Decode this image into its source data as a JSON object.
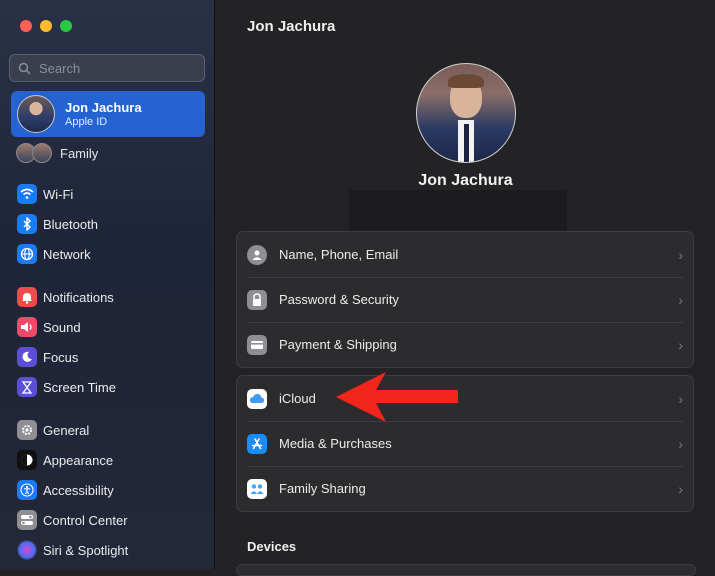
{
  "window": {
    "title": "Jon Jachura"
  },
  "sidebar": {
    "search_placeholder": "Search",
    "account": {
      "name": "Jon Jachura",
      "subtitle": "Apple ID"
    },
    "family_label": "Family",
    "items": [
      {
        "label": "Wi-Fi",
        "icon": "wifi-icon",
        "color": "#1a7cf5"
      },
      {
        "label": "Bluetooth",
        "icon": "bluetooth-icon",
        "color": "#1a7cf5"
      },
      {
        "label": "Network",
        "icon": "globe-icon",
        "color": "#1a7cf5"
      },
      {
        "label": "Notifications",
        "icon": "bell-icon",
        "color": "#ee4b4b"
      },
      {
        "label": "Sound",
        "icon": "speaker-icon",
        "color": "#ee4b6a"
      },
      {
        "label": "Focus",
        "icon": "moon-icon",
        "color": "#5b4fd6"
      },
      {
        "label": "Screen Time",
        "icon": "hourglass-icon",
        "color": "#5b4fd6"
      },
      {
        "label": "General",
        "icon": "gear-icon",
        "color": "#8e8e93"
      },
      {
        "label": "Appearance",
        "icon": "appearance-icon",
        "color": "#111111"
      },
      {
        "label": "Accessibility",
        "icon": "accessibility-icon",
        "color": "#1a7cf5"
      },
      {
        "label": "Control Center",
        "icon": "control-center-icon",
        "color": "#8e8e93"
      },
      {
        "label": "Siri & Spotlight",
        "icon": "siri-icon",
        "color": "#222222"
      }
    ]
  },
  "main": {
    "title": "Jon Jachura",
    "profile_name": "Jon Jachura",
    "group1": [
      {
        "label": "Name, Phone, Email",
        "icon": "person-icon"
      },
      {
        "label": "Password & Security",
        "icon": "lock-icon"
      },
      {
        "label": "Payment & Shipping",
        "icon": "creditcard-icon"
      }
    ],
    "group2": [
      {
        "label": "iCloud",
        "icon": "icloud-icon"
      },
      {
        "label": "Media & Purchases",
        "icon": "appstore-icon"
      },
      {
        "label": "Family Sharing",
        "icon": "family-sharing-icon"
      }
    ],
    "devices_header": "Devices",
    "chevron": "›"
  },
  "annotation": {
    "arrow_color": "#f3261b"
  }
}
